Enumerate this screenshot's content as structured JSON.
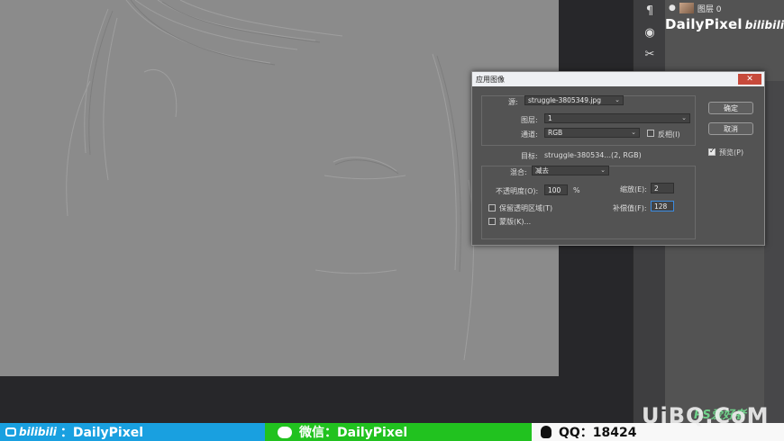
{
  "layers_panel": {
    "layer_name": "图层 0"
  },
  "watermark": {
    "name": "DailyPixel",
    "bilibili": "bilibili"
  },
  "dialog": {
    "title": "应用图像",
    "close_glyph": "✕",
    "source_label": "源:",
    "source_value": "struggle-3805349.jpg",
    "layer_label": "图层:",
    "layer_value": "1",
    "channel_label": "通道:",
    "channel_value": "RGB",
    "invert_label": "反相(I)",
    "invert_checked": false,
    "target_label": "目标:",
    "target_value": "struggle-380534...(2, RGB)",
    "blending_label": "混合:",
    "blending_value": "减去",
    "opacity_label": "不透明度(O):",
    "opacity_value": "100",
    "opacity_unit": "%",
    "scale_label": "缩放(E):",
    "scale_value": "2",
    "offset_label": "补偿值(F):",
    "offset_value": "128",
    "preserve_transparency_label": "保留透明区域(T)",
    "preserve_transparency_checked": false,
    "mask_label": "蒙版(K)...",
    "mask_checked": false,
    "ok_label": "确定",
    "cancel_label": "取消",
    "preview_label": "预览(P)",
    "preview_checked": true
  },
  "banner": {
    "bilibili_label": "bilibili",
    "bilibili_text": "：DailyPixel",
    "wechat_text": "微信：DailyPixel",
    "qq_text": "QQ：18424"
  },
  "corner_watermark": {
    "site": "UiBQ.CoM",
    "ps": "PS爱好者"
  },
  "colors": {
    "canvas": "#8b8b8b",
    "banner_blue": "#19a0e0",
    "banner_green": "#21c21f",
    "close_red": "#c74a3b"
  }
}
